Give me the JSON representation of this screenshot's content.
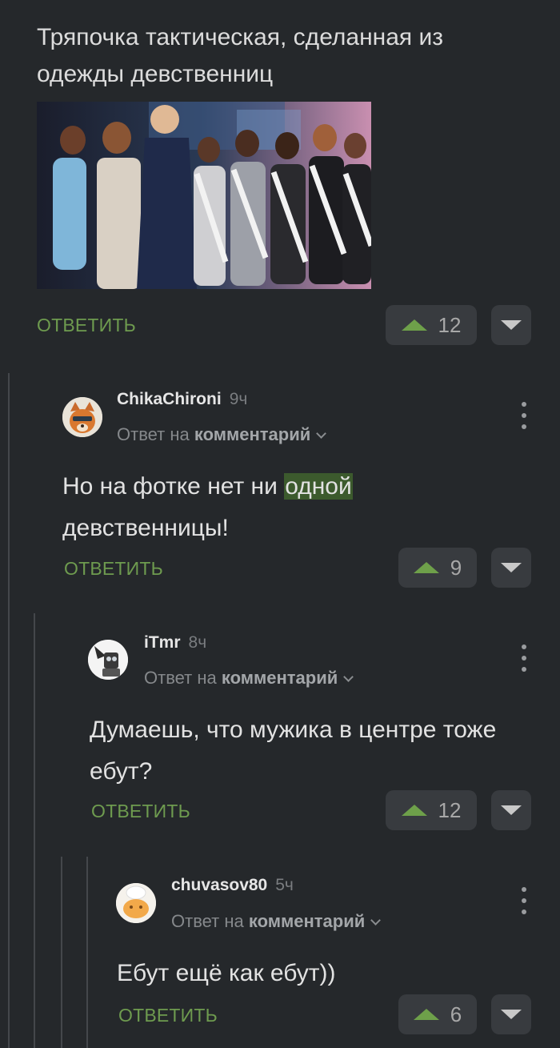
{
  "post": {
    "text": "Тряпочка тактическая, сделанная из одежды девственниц",
    "reply_label": "ОТВЕТИТЬ",
    "votes": "12"
  },
  "comments": [
    {
      "username": "ChikaChironi",
      "time": "9ч",
      "meta_prefix": "Ответ на",
      "meta_link": "комментарий",
      "text_before": "Но на фотке нет ни ",
      "text_highlight": "одной",
      "text_after": " девственницы!",
      "reply_label": "ОТВЕТИТЬ",
      "votes": "9"
    },
    {
      "username": "iTmr",
      "time": "8ч",
      "meta_prefix": "Ответ на",
      "meta_link": "комментарий",
      "text": "Думаешь, что мужика в центре тоже ебут?",
      "reply_label": "ОТВЕТИТЬ",
      "votes": "12"
    },
    {
      "username": "chuvasov80",
      "time": "5ч",
      "meta_prefix": "Ответ на",
      "meta_link": "комментарий",
      "text": "Ебут ещё как ебут))",
      "reply_label": "ОТВЕТИТЬ",
      "votes": "6"
    }
  ],
  "colors": {
    "background": "#25282b",
    "accent_green": "#6e9b4f",
    "button_bg": "#383b3f",
    "highlight": "#3c5a2d"
  }
}
